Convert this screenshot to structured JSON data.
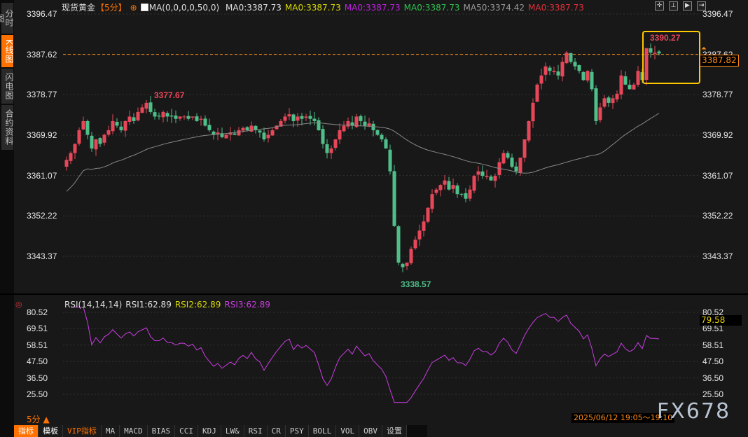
{
  "sidebar": {
    "tabs": [
      {
        "label": "分时图"
      },
      {
        "label": "K线图",
        "active": true
      },
      {
        "label": "闪电图"
      },
      {
        "label": "合约资料"
      }
    ]
  },
  "header": {
    "symbol": "现货黄金",
    "period": "【5分】",
    "ma_params": "MA(0,0,0,0,50,0)",
    "ma_items": [
      {
        "text": "MA0:3387.73",
        "color": "#e0e0e0"
      },
      {
        "text": "MA0:3387.73",
        "color": "#d8d800"
      },
      {
        "text": "MA0:3387.73",
        "color": "#c020e0"
      },
      {
        "text": "MA0:3387.73",
        "color": "#30c050"
      },
      {
        "text": "MA50:3374.42",
        "color": "#999999"
      },
      {
        "text": "MA0:3387.73",
        "color": "#e0303a"
      }
    ]
  },
  "toolbar_icons": [
    "crosshair-icon",
    "zoom-range-icon",
    "play-icon",
    "scroll-end-icon"
  ],
  "colors": {
    "up": "#e8475a",
    "down": "#4fbf8a",
    "ma50": "#888888",
    "rsi": "#c83ee0",
    "current": "#ff8c1a"
  },
  "chart_data": [
    {
      "type": "candlestick",
      "title": "现货黄金 5分",
      "y_ticks": [
        "3396.47",
        "3387.62",
        "3378.77",
        "3369.92",
        "3361.07",
        "3352.22",
        "3343.37"
      ],
      "ylim": [
        3338.0,
        3396.47
      ],
      "current_price": "3387.82",
      "reference_line": 3387.62,
      "high_label": "3390.27",
      "low_label": "3338.57",
      "local_high_label": "3377.67",
      "closes": [
        3364.5,
        3366,
        3368,
        3371,
        3373,
        3370,
        3367,
        3369,
        3368,
        3370,
        3371,
        3373,
        3372,
        3371,
        3373,
        3374,
        3373,
        3375,
        3376,
        3377,
        3375,
        3374,
        3374,
        3375,
        3374,
        3374,
        3373.5,
        3374,
        3374,
        3373.5,
        3374,
        3373,
        3373.5,
        3372,
        3371,
        3370,
        3370.5,
        3369.5,
        3370,
        3370.5,
        3370,
        3371,
        3371.5,
        3371,
        3372,
        3371,
        3370.5,
        3369,
        3370,
        3371,
        3372,
        3373,
        3374,
        3374.5,
        3373,
        3374,
        3373.5,
        3374,
        3373.5,
        3373,
        3371,
        3368,
        3366,
        3367,
        3369,
        3371,
        3372,
        3373,
        3372,
        3374,
        3373,
        3372,
        3372.5,
        3371,
        3370,
        3369,
        3367,
        3362,
        3350,
        3342,
        3341,
        3342,
        3345,
        3347,
        3349,
        3351,
        3354,
        3357,
        3358,
        3359,
        3360,
        3358,
        3359,
        3357,
        3357,
        3356,
        3358,
        3361,
        3362,
        3361,
        3361,
        3360,
        3361,
        3364,
        3366,
        3365,
        3363,
        3362,
        3365,
        3369,
        3373,
        3377,
        3381,
        3383,
        3385,
        3384,
        3384,
        3383,
        3386,
        3388,
        3386,
        3385,
        3384,
        3382,
        3384,
        3380,
        3373,
        3376,
        3378,
        3377,
        3378,
        3379,
        3383,
        3381,
        3380,
        3381,
        3384,
        3382,
        3389,
        3388,
        3388,
        3387.82
      ],
      "ma_period": 50
    },
    {
      "type": "line",
      "title": "RSI(14,14,14)",
      "items": [
        {
          "text": "RSI1:62.89",
          "color": "#e0e0e0"
        },
        {
          "text": "RSI2:62.89",
          "color": "#d8d800"
        },
        {
          "text": "RSI3:62.89",
          "color": "#c83ee0"
        }
      ],
      "y_ticks": [
        "80.52",
        "69.51",
        "58.51",
        "47.50",
        "36.50",
        "25.50"
      ],
      "ylim": [
        25.5,
        80.52
      ],
      "current": "79.58",
      "period": 14
    }
  ],
  "bottom": {
    "period": "5分 ▲",
    "time_range": "2025/06/12 19:05～19:10",
    "watermark": "FX678",
    "tabs": [
      {
        "label": "指标",
        "style": "act"
      },
      {
        "label": "模板",
        "style": "white"
      },
      {
        "label": "VIP指标",
        "style": "vip"
      },
      {
        "label": "MA"
      },
      {
        "label": "MACD"
      },
      {
        "label": "BIAS"
      },
      {
        "label": "CCI"
      },
      {
        "label": "KDJ"
      },
      {
        "label": "LW&"
      },
      {
        "label": "RSI"
      },
      {
        "label": "CR"
      },
      {
        "label": "PSY"
      },
      {
        "label": "BOLL"
      },
      {
        "label": "VOL"
      },
      {
        "label": "OBV"
      },
      {
        "label": "设置"
      }
    ]
  }
}
